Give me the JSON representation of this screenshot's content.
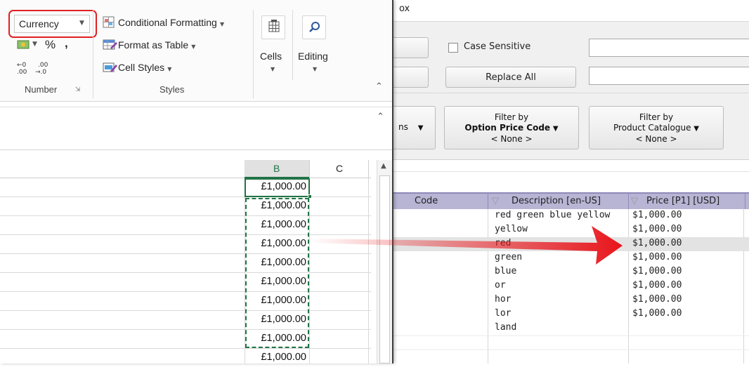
{
  "excel": {
    "number_format": "Currency",
    "conditional_formatting": "Conditional Formatting",
    "format_as_table": "Format as Table",
    "cell_styles": "Cell Styles",
    "cells": "Cells",
    "editing": "Editing",
    "group_number": "Number",
    "group_styles": "Styles",
    "percent": "%",
    "comma": ",",
    "inc_decimal": ".00",
    "dec_decimal": ".0",
    "col_b": "B",
    "col_c": "C",
    "cell_values": [
      "£1,000.00",
      "£1,000.00",
      "£1,000.00",
      "£1,000.00",
      "£1,000.00",
      "£1,000.00",
      "£1,000.00",
      "£1,000.00",
      "£1,000.00",
      "£1,000.00"
    ],
    "highlight_color": "#e02020",
    "selection_color": "#217346"
  },
  "app": {
    "title_fragment": "ox",
    "case_sensitive": "Case Sensitive",
    "replace_all": "Replace All",
    "options_fragment": "ns",
    "filter1_line1": "Filter by",
    "filter1_line2": "Option Price Code",
    "filter1_line3": "< None >",
    "filter2_line1": "Filter by",
    "filter2_line2": "Product Catalogue",
    "filter2_line3": "< None >",
    "headers": [
      "Code",
      "Description [en-US]",
      "Price [P1] [USD]"
    ],
    "rows": [
      {
        "desc": "red green blue yellow",
        "price": "$1,000.00"
      },
      {
        "desc": "yellow",
        "price": "$1,000.00"
      },
      {
        "desc": "red",
        "price": "$1,000.00"
      },
      {
        "desc": "green",
        "price": "$1,000.00"
      },
      {
        "desc": "blue",
        "price": "$1,000.00"
      },
      {
        "desc": "or",
        "price": "$1,000.00"
      },
      {
        "desc": "hor",
        "price": "$1,000.00"
      },
      {
        "desc": "lor",
        "price": "$1,000.00"
      },
      {
        "desc": "land",
        "price": ""
      }
    ],
    "header_bg": "#b7b4d4",
    "selected_row_bg": "#e3e3e3"
  },
  "arrow_color": "#e8151b"
}
